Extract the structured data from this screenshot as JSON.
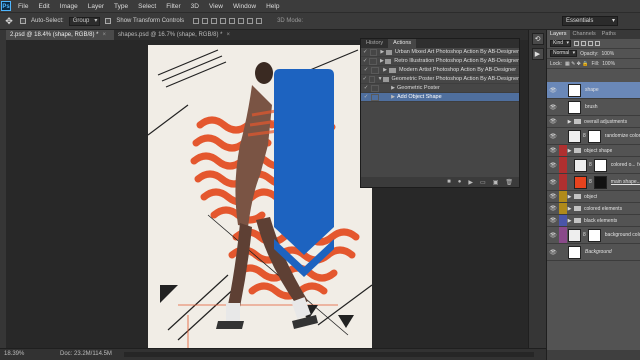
{
  "app": {
    "logo": "Ps"
  },
  "menu": [
    "File",
    "Edit",
    "Image",
    "Layer",
    "Type",
    "Select",
    "Filter",
    "3D",
    "View",
    "Window",
    "Help"
  ],
  "options": {
    "auto_select_label": "Auto-Select:",
    "auto_select_value": "Group",
    "show_transform_label": "Show Transform Controls",
    "mode_3d_label": "3D Mode:",
    "workspace": "Essentials"
  },
  "doc_tabs": [
    {
      "label": "2.psd @ 18.4% (shape, RGB/8) *",
      "active": true
    },
    {
      "label": "shapes.psd @ 16.7% (shape, RGB/8) *",
      "active": false
    }
  ],
  "status": {
    "zoom": "18.39%",
    "doc": "Doc: 23.2M/114.5M"
  },
  "actions_panel": {
    "tabs": [
      "History",
      "Actions"
    ],
    "rows": [
      {
        "label": "Urban Mixed Art Photoshop Action By AB-Designer",
        "level": 0,
        "selected": false
      },
      {
        "label": "Retro Illustration Photoshop Action By AB-Designer",
        "level": 0,
        "selected": false
      },
      {
        "label": "Modern Artist Photoshop Action By AB-Designer",
        "level": 0,
        "selected": false
      },
      {
        "label": "Geometric Poster Photoshop Action By AB-Designer",
        "level": 0,
        "selected": false
      },
      {
        "label": "Geometric Poster",
        "level": 1,
        "selected": false
      },
      {
        "label": "Add Object Shape",
        "level": 1,
        "selected": true
      }
    ]
  },
  "layers_panel": {
    "tabs": [
      "Layers",
      "Channels",
      "Paths"
    ],
    "filter_kind": "Kind",
    "blend_mode": "Normal",
    "opacity_label": "Opacity:",
    "opacity_value": "100%",
    "lock_label": "Lock:",
    "fill_label": "Fill:",
    "fill_value": "100%",
    "layers": [
      {
        "name": "shape",
        "color": "",
        "type": "pixel",
        "selected": true,
        "indent": false,
        "fx": false
      },
      {
        "name": "brush",
        "color": "",
        "type": "pixel",
        "selected": false,
        "indent": false,
        "fx": false
      },
      {
        "name": "overall adjustments",
        "color": "",
        "type": "group",
        "selected": false,
        "indent": false,
        "fx": false
      },
      {
        "name": "randomize color",
        "color": "",
        "type": "adjust",
        "selected": false,
        "indent": false,
        "fx": false
      },
      {
        "name": "object shape",
        "color": "#b03030",
        "type": "group",
        "selected": false,
        "indent": false,
        "fx": false
      },
      {
        "name": "colored o...",
        "color": "#b03030",
        "type": "adjust",
        "selected": false,
        "indent": true,
        "fx": true
      },
      {
        "name": "main shape...",
        "color": "#b03030",
        "type": "pixel",
        "selected": false,
        "indent": true,
        "fx": false,
        "underline": true
      },
      {
        "name": "object",
        "color": "#b08a1a",
        "type": "group",
        "selected": false,
        "indent": false,
        "fx": false
      },
      {
        "name": "colored elements",
        "color": "#b08a1a",
        "type": "group",
        "selected": false,
        "indent": false,
        "fx": false
      },
      {
        "name": "black elements",
        "color": "#4a55a8",
        "type": "group",
        "selected": false,
        "indent": false,
        "fx": false
      },
      {
        "name": "background color",
        "color": "#8a4a8a",
        "type": "adjust",
        "selected": false,
        "indent": false,
        "fx": false
      },
      {
        "name": "Background",
        "color": "",
        "type": "pixel",
        "selected": false,
        "indent": false,
        "fx": false,
        "italic": true
      }
    ]
  }
}
